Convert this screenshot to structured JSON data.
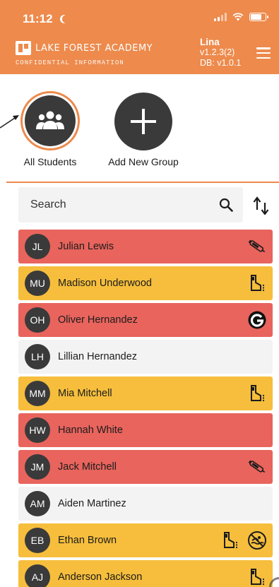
{
  "status_bar": {
    "time": "11:12"
  },
  "header": {
    "school_name": "LAKE FOREST ACADEMY",
    "school_subtitle": "CONFIDENTIAL INFORMATION",
    "user_name": "Lina",
    "app_version": "v1.2.3(2)",
    "db_version": "DB: v1.0.1"
  },
  "groups": {
    "all_students_label": "All Students",
    "add_group_label": "Add New Group"
  },
  "search": {
    "placeholder": "Search"
  },
  "colors": {
    "accent": "#ED8A4C",
    "alert_red": "#E8645D",
    "warning_yellow": "#F6BE3C",
    "neutral": "#F3F3F3"
  },
  "students": [
    {
      "initials": "JL",
      "name": "Julian Lewis",
      "status": "red",
      "icons": [
        "epipen-icon"
      ]
    },
    {
      "initials": "MU",
      "name": "Madison Underwood",
      "status": "yellow",
      "icons": [
        "inhaler-icon"
      ]
    },
    {
      "initials": "OH",
      "name": "Oliver Hernandez",
      "status": "red",
      "icons": [
        "gluten-free-icon"
      ]
    },
    {
      "initials": "LH",
      "name": "Lillian Hernandez",
      "status": "none",
      "icons": []
    },
    {
      "initials": "MM",
      "name": "Mia Mitchell",
      "status": "yellow",
      "icons": [
        "inhaler-icon"
      ]
    },
    {
      "initials": "HW",
      "name": "Hannah White",
      "status": "red",
      "icons": []
    },
    {
      "initials": "JM",
      "name": "Jack Mitchell",
      "status": "red",
      "icons": [
        "epipen-icon"
      ]
    },
    {
      "initials": "AM",
      "name": "Aiden Martinez",
      "status": "none",
      "icons": []
    },
    {
      "initials": "EB",
      "name": "Ethan Brown",
      "status": "yellow",
      "icons": [
        "inhaler-icon",
        "no-swimming-icon"
      ]
    },
    {
      "initials": "AJ",
      "name": "Anderson Jackson",
      "status": "yellow",
      "icons": [
        "inhaler-icon"
      ]
    }
  ]
}
